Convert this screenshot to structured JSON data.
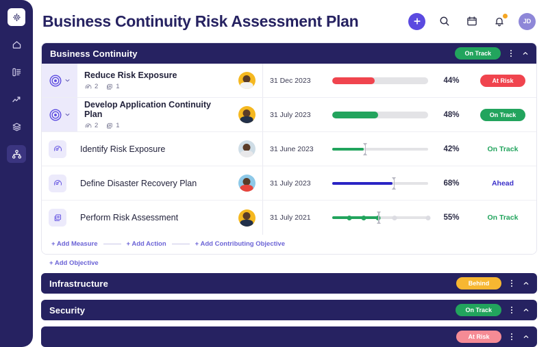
{
  "sidebar": {
    "logo_name": "app-logo",
    "items": [
      {
        "name": "home",
        "label": "Home"
      },
      {
        "name": "reports",
        "label": "Reports"
      },
      {
        "name": "analytics",
        "label": "Analytics"
      },
      {
        "name": "layers",
        "label": "Layers"
      },
      {
        "name": "hierarchy",
        "label": "Strategy Map",
        "active": true
      }
    ]
  },
  "header": {
    "title": "Business Continuity Risk Assessment Plan",
    "actions": {
      "add_label": "+",
      "search_label": "Search",
      "calendar_label": "Calendar",
      "notifications_label": "Notifications",
      "avatar_initials": "JD"
    }
  },
  "colors": {
    "navy": "#262261",
    "purple": "#5b4ae0",
    "green": "#22a45d",
    "red": "#f0444e",
    "amber": "#f7b731",
    "salmon": "#f58b95",
    "blue": "#2a24c4",
    "lavender": "#eceafb"
  },
  "sections": [
    {
      "title": "Business Continuity",
      "status": "On Track",
      "status_color": "#22a45d",
      "expanded": true,
      "rows": [
        {
          "type": "objective",
          "icon": "target-icon",
          "highlight": true,
          "title": "Reduce Risk Exposure",
          "counts": [
            {
              "icon": "gauge-icon",
              "value": "2"
            },
            {
              "icon": "documents-icon",
              "value": "1"
            }
          ],
          "avatar": {
            "bg": "#f5b820",
            "shirt": "#f2f2f2"
          },
          "date": "31 Dec 2023",
          "progress": {
            "style": "thick",
            "value": 44,
            "color": "#f0444e"
          },
          "percent": "44%",
          "status": {
            "label": "At Risk",
            "style": "pill",
            "color": "#f0444e"
          }
        },
        {
          "type": "objective",
          "icon": "target-icon",
          "highlight": true,
          "title": "Develop Application Continuity Plan",
          "counts": [
            {
              "icon": "gauge-icon",
              "value": "2"
            },
            {
              "icon": "documents-icon",
              "value": "1"
            }
          ],
          "avatar": {
            "bg": "#f5b820",
            "shirt": "#22304a"
          },
          "date": "31 July 2023",
          "progress": {
            "style": "thick",
            "value": 48,
            "color": "#22a45d"
          },
          "percent": "48%",
          "status": {
            "label": "On Track",
            "style": "pill",
            "color": "#22a45d"
          }
        },
        {
          "type": "measure",
          "icon": "gauge-icon",
          "highlight": false,
          "title": "Identify Risk Exposure",
          "counts": [],
          "avatar": {
            "bg": "#cfdde6",
            "shirt": "#e8e8ea"
          },
          "date": "31 June 2023",
          "progress": {
            "style": "thin",
            "value": 33,
            "target": 34,
            "color": "#22a45d",
            "dots": []
          },
          "percent": "42%",
          "status": {
            "label": "On Track",
            "style": "text",
            "color": "#22a45d"
          }
        },
        {
          "type": "measure",
          "icon": "gauge-icon",
          "highlight": false,
          "title": "Define Disaster Recovery Plan",
          "counts": [],
          "avatar": {
            "bg": "#8ec9e8",
            "shirt": "#e8453c"
          },
          "date": "31 July 2023",
          "progress": {
            "style": "thin",
            "value": 63,
            "target": 64,
            "color": "#2a24c4",
            "dots": []
          },
          "percent": "68%",
          "status": {
            "label": "Ahead",
            "style": "text",
            "color": "#3b30c9"
          }
        },
        {
          "type": "action",
          "icon": "documents-icon",
          "highlight": false,
          "title": "Perform Risk Assessment",
          "counts": [],
          "avatar": {
            "bg": "#f5b820",
            "shirt": "#22304a"
          },
          "date": "31 July 2021",
          "progress": {
            "style": "thin",
            "value": 48,
            "target": 48,
            "color": "#22a45d",
            "dots": [
              {
                "pos": 18,
                "filled": true
              },
              {
                "pos": 33,
                "filled": true
              },
              {
                "pos": 48,
                "filled": true
              },
              {
                "pos": 65,
                "filled": false
              },
              {
                "pos": 100,
                "filled": false
              }
            ]
          },
          "percent": "55%",
          "status": {
            "label": "On Track",
            "style": "text",
            "color": "#22a45d"
          }
        }
      ],
      "add_links": [
        "+ Add Measure",
        "+ Add Action",
        "+ Add Contributing Objective"
      ],
      "add_objective": "+ Add Objective"
    },
    {
      "title": "Infrastructure",
      "status": "Behind",
      "status_color": "#f7b731",
      "expanded": false,
      "rows": []
    },
    {
      "title": "Security",
      "status": "On Track",
      "status_color": "#22a45d",
      "expanded": false,
      "rows": []
    },
    {
      "title": "",
      "status": "At Risk",
      "status_color": "#f58b95",
      "expanded": false,
      "rows": []
    }
  ]
}
